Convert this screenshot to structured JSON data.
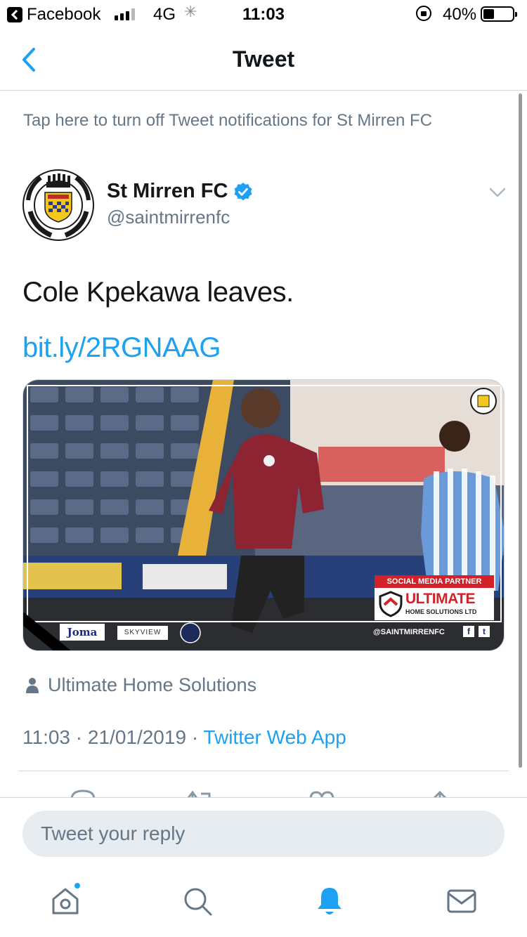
{
  "status_bar": {
    "back_app": "Facebook",
    "network": "4G",
    "time": "11:03",
    "battery_pct_text": "40%",
    "battery_level": 0.4
  },
  "nav": {
    "title": "Tweet"
  },
  "notification_bar": {
    "text": "Tap here to turn off Tweet notifications for St Mirren FC"
  },
  "tweet": {
    "author_name": "St Mirren FC",
    "author_handle": "@saintmirrenfc",
    "verified": true,
    "text": "Cole Kpekawa leaves.",
    "link": "bit.ly/2RGNAAG",
    "media": {
      "social_label": "SOCIAL MEDIA PARTNER",
      "sponsor_name": "ULTIMATE",
      "sponsor_sub": "HOME SOLUTIONS LTD",
      "club_handle": "@SAINTMIRRENFC",
      "kit_brand": "Joma",
      "sponsor_2": "SKYVIEW",
      "fb": "f",
      "tw": "t"
    },
    "place": "Ultimate Home Solutions",
    "time": "11:03",
    "date": "21/01/2019",
    "sep": "·",
    "source": "Twitter Web App"
  },
  "composer": {
    "placeholder": "Tweet your reply"
  },
  "colors": {
    "accent": "#1da1f2",
    "muted": "#657786",
    "text": "#14171a",
    "sponsor_red": "#d22128"
  },
  "icons": {
    "nav_back": "chevron-left-icon",
    "tabs": [
      "home-icon",
      "search-icon",
      "bell-icon",
      "mail-icon"
    ],
    "actions": [
      "reply-icon",
      "retweet-icon",
      "like-icon",
      "share-icon"
    ]
  }
}
